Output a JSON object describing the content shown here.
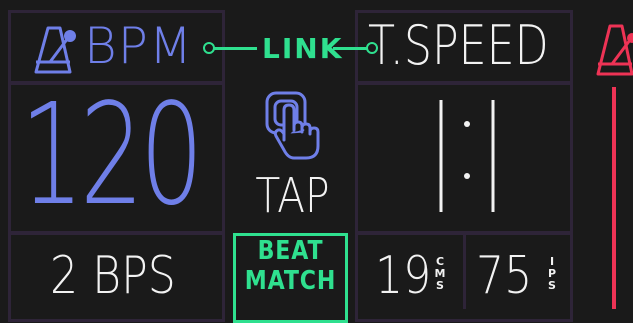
{
  "bpm_panel": {
    "label": "BPM",
    "value": "120",
    "bps": "2 BPS",
    "icon": "metronome-icon",
    "color": "#6f7fe8"
  },
  "link": {
    "label": "LINK",
    "color": "#2fe08f"
  },
  "tap": {
    "label": "TAP",
    "icon": "tap-hand-icon"
  },
  "beat_match": {
    "line1": "BEAT",
    "line2": "MATCH"
  },
  "tape_speed_panel": {
    "label": "T.SPEED",
    "ratio": "1:1",
    "cms_value": "19",
    "cms_unit": "CMS",
    "ips_value": "75",
    "ips_unit": "IPS"
  },
  "next_panel": {
    "icon": "metronome-icon",
    "color": "#ee3355"
  },
  "colors": {
    "background": "#1a1a1a",
    "border": "#2e2438",
    "text": "#f2f2f2"
  }
}
